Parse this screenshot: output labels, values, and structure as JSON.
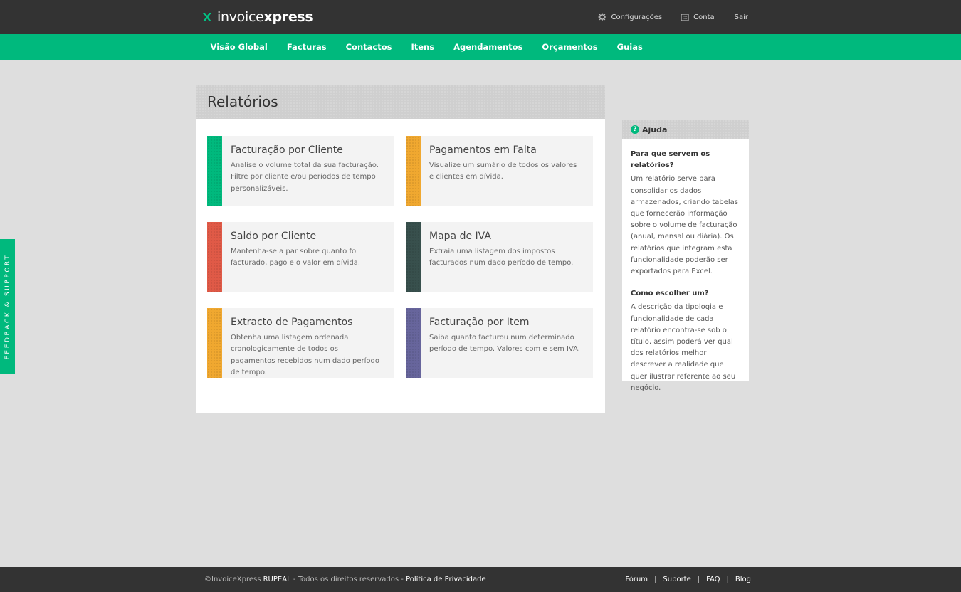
{
  "header": {
    "logo_light": "invoice",
    "logo_bold": "xpress",
    "links": [
      {
        "label": "Configurações",
        "icon": "gear-icon"
      },
      {
        "label": "Conta",
        "icon": "building-icon"
      },
      {
        "label": "Sair"
      }
    ]
  },
  "nav": {
    "items": [
      "Visão Global",
      "Facturas",
      "Contactos",
      "Itens",
      "Agendamentos",
      "Orçamentos",
      "Guias"
    ]
  },
  "feedback_label": "FEEDBACK & SUPPORT",
  "reports": {
    "title": "Relatórios",
    "cards": [
      {
        "title": "Facturação por Cliente",
        "desc": "Analise o volume total da sua facturação. Filtre por cliente e/ou períodos de tempo personalizáveis.",
        "color": "#00b97d"
      },
      {
        "title": "Pagamentos em Falta",
        "desc": "Visualize um sumário de todos os valores e clientes em dívida.",
        "color": "#f0a830"
      },
      {
        "title": "Saldo por Cliente",
        "desc": "Mantenha-se a par sobre quanto foi facturado, pago e o valor em dívida.",
        "color": "#e05a47"
      },
      {
        "title": "Mapa de IVA",
        "desc": "Extraia uma listagem dos impostos facturados num dado período de tempo.",
        "color": "#38504d"
      },
      {
        "title": "Extracto de Pagamentos",
        "desc": "Obtenha uma listagem ordenada cronologicamente de todos os pagamentos recebidos num dado período de tempo.",
        "color": "#f0a830"
      },
      {
        "title": "Facturação por Item",
        "desc": "Saiba quanto facturou num determinado período de tempo. Valores com e sem IVA.",
        "color": "#67659c"
      }
    ]
  },
  "help": {
    "title": "Ajuda",
    "q1": "Para que servem os relatórios?",
    "a1": "Um relatório serve para consolidar os dados armazenados, criando tabelas que fornecerão informação sobre o volume de facturação (anual, mensal ou diária). Os relatórios que integram esta funcionalidade poderão ser exportados para Excel.",
    "q2": "Como escolher um?",
    "a2": "A descrição da tipologia e funcionalidade de cada relatório encontra-se sob o título, assim poderá ver qual dos relatórios melhor descrever a realidade que quer ilustrar referente ao seu negócio."
  },
  "footer": {
    "copyright": "©InvoiceXpress",
    "company": "RUPEAL",
    "rights": " - Todos os direitos reservados - ",
    "privacy": "Política de Privacidade",
    "links": [
      "Fórum",
      "Suporte",
      "FAQ",
      "Blog"
    ],
    "separator": "|"
  }
}
